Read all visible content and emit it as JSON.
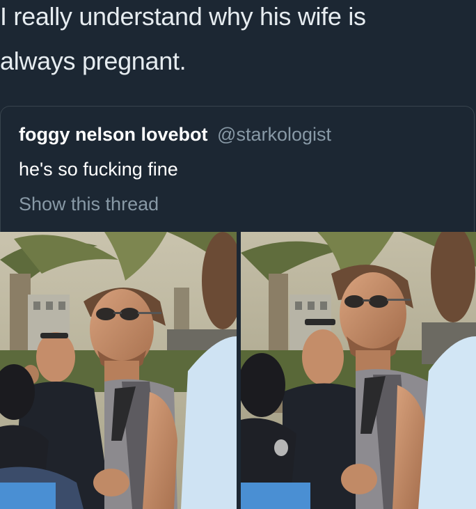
{
  "tweet": {
    "text_line1": "I really understand why his wife is",
    "text_line2": "always pregnant."
  },
  "quote": {
    "display_name": "foggy nelson lovebot",
    "handle": "@starkologist",
    "text": "he's so fucking fine",
    "thread_link": "Show this thread"
  },
  "media": {
    "images": [
      {
        "name": "photo-left"
      },
      {
        "name": "photo-right"
      }
    ]
  },
  "colors": {
    "background": "#1c2733",
    "text_primary": "#e6ecf0",
    "text_secondary": "#8899a6",
    "border": "#38444d"
  }
}
